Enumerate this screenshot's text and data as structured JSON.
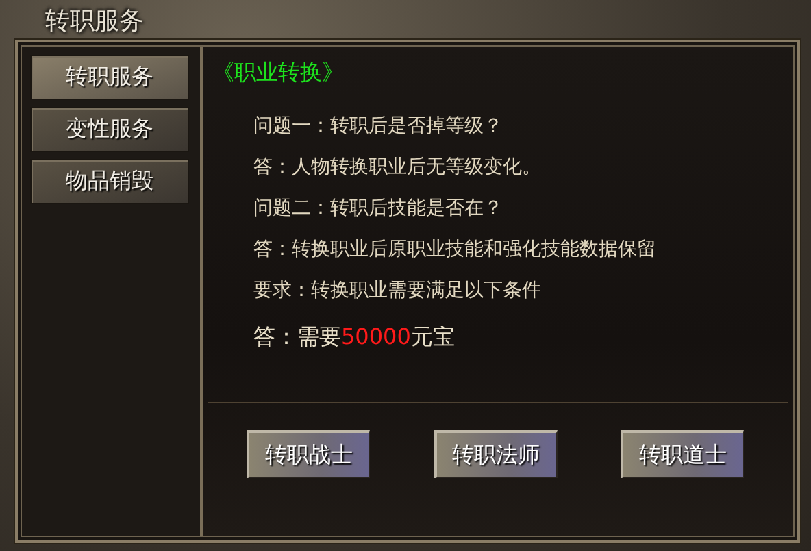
{
  "window": {
    "title": "转职服务"
  },
  "tabs": [
    {
      "label": "转职服务",
      "selected": true
    },
    {
      "label": "变性服务",
      "selected": false
    },
    {
      "label": "物品销毁",
      "selected": false
    }
  ],
  "content": {
    "heading": "《职业转换》",
    "lines": [
      "问题一：转职后是否掉等级？",
      "答：人物转换职业后无等级变化。",
      "问题二：转职后技能是否在？",
      "答：转换职业后原职业技能和强化技能数据保留",
      "要求：转换职业需要满足以下条件"
    ],
    "cost": {
      "prefix": "答：需要",
      "amount": "50000",
      "suffix": "元宝"
    }
  },
  "buttons": [
    "转职战士",
    "转职法师",
    "转职道士"
  ]
}
